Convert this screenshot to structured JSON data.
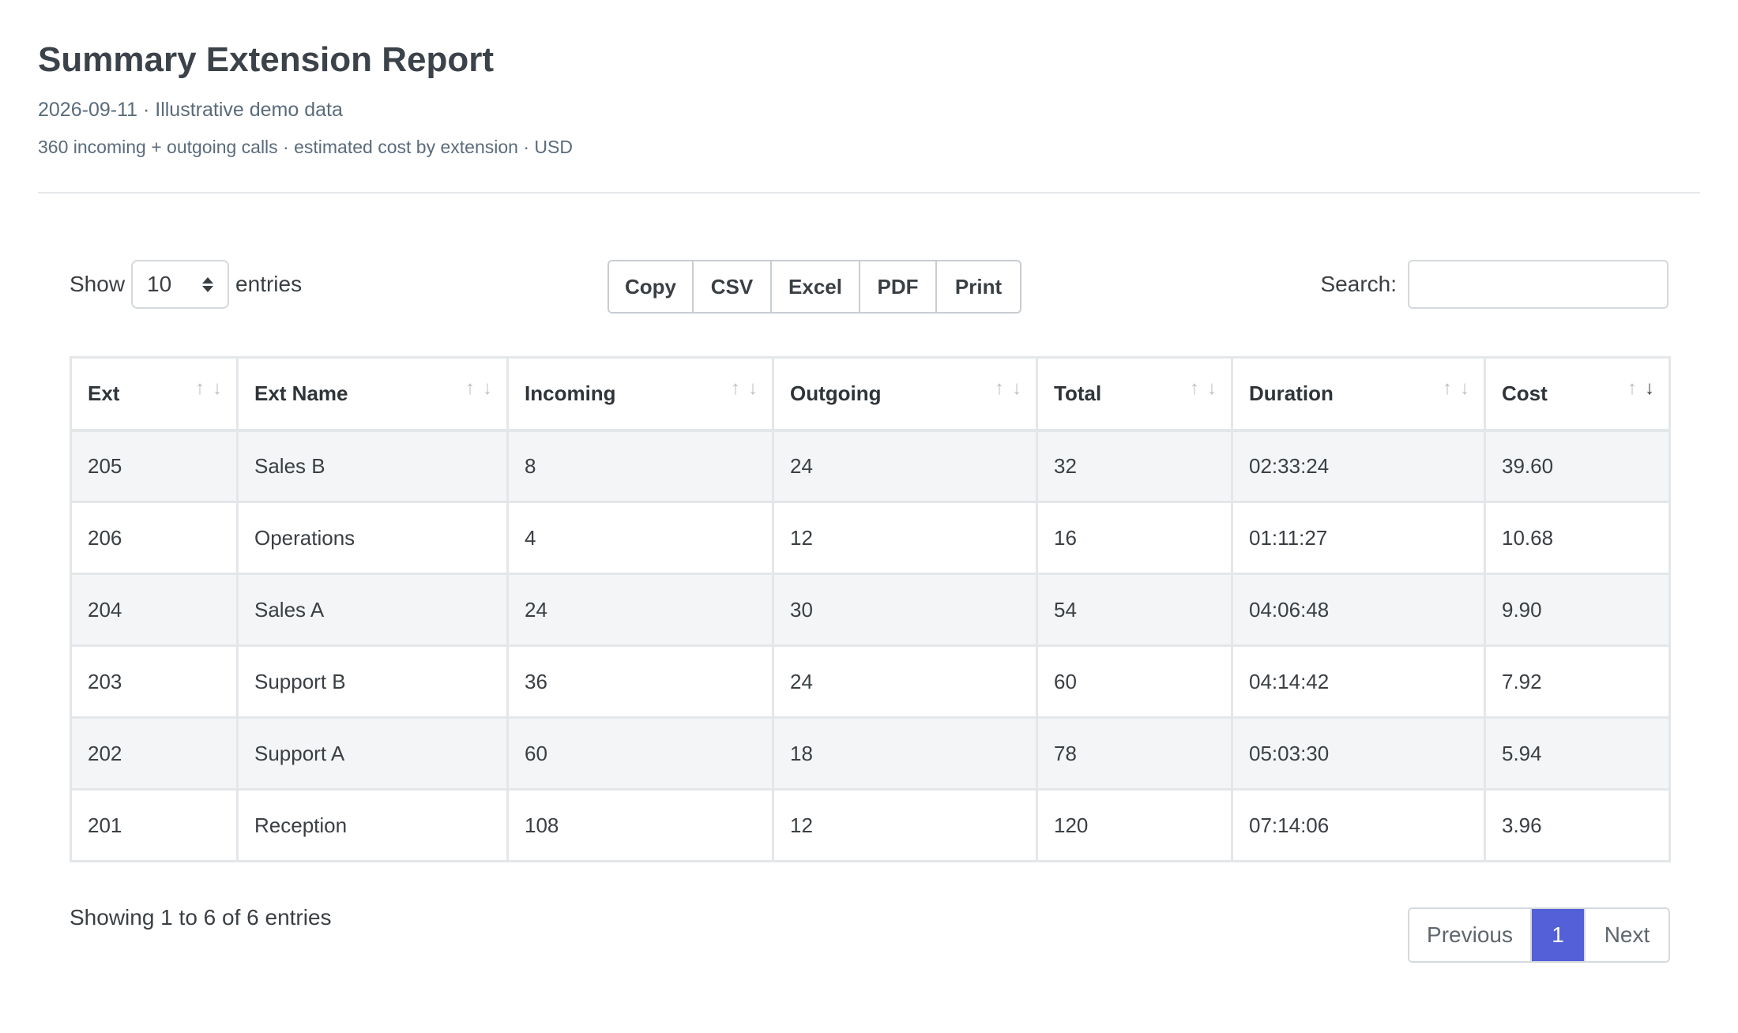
{
  "header": {
    "title": "Summary Extension Report",
    "subtitle": "2026-09-11 · Illustrative demo data",
    "description": "360 incoming + outgoing calls · estimated cost by extension · USD"
  },
  "controls": {
    "show_label": "Show",
    "entries_value": "10",
    "entries_label": "entries",
    "buttons": {
      "copy": "Copy",
      "csv": "CSV",
      "excel": "Excel",
      "pdf": "PDF",
      "print": "Print"
    },
    "search_label": "Search:",
    "search_value": ""
  },
  "table": {
    "columns": [
      "Ext",
      "Ext Name",
      "Incoming",
      "Outgoing",
      "Total",
      "Duration",
      "Cost"
    ],
    "sorted_column": "Cost",
    "sort_direction": "descending",
    "rows": [
      [
        "205",
        "Sales B",
        "8",
        "24",
        "32",
        "02:33:24",
        "39.60"
      ],
      [
        "206",
        "Operations",
        "4",
        "12",
        "16",
        "01:11:27",
        "10.68"
      ],
      [
        "204",
        "Sales A",
        "24",
        "30",
        "54",
        "04:06:48",
        "9.90"
      ],
      [
        "203",
        "Support B",
        "36",
        "24",
        "60",
        "04:14:42",
        "7.92"
      ],
      [
        "202",
        "Support A",
        "60",
        "18",
        "78",
        "05:03:30",
        "5.94"
      ],
      [
        "201",
        "Reception",
        "108",
        "12",
        "120",
        "07:14:06",
        "3.96"
      ]
    ]
  },
  "footer": {
    "info": "Showing 1 to 6 of 6 entries",
    "pagination": {
      "previous": "Previous",
      "current_page": "1",
      "next": "Next"
    }
  },
  "colors": {
    "accent": "#5360d8",
    "stripe": "#f4f5f6",
    "border": "#e4e7ea"
  }
}
